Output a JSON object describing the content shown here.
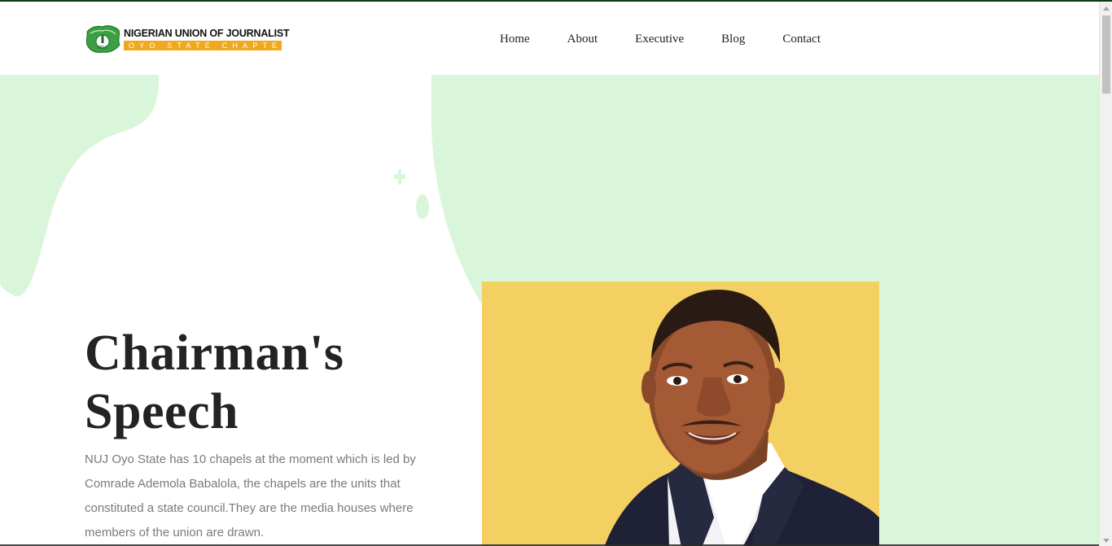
{
  "header": {
    "logo_title": "NIGERIAN UNION OF JOURNALIST",
    "logo_subtitle": "OYO STATE CHAPTER",
    "logo_badge": "NUJ"
  },
  "nav": {
    "items": [
      {
        "label": "Home"
      },
      {
        "label": "About"
      },
      {
        "label": "Executive"
      },
      {
        "label": "Blog"
      },
      {
        "label": "Contact"
      }
    ]
  },
  "hero": {
    "title_line1": "Chairman's",
    "title_line2": "Speech",
    "body": "NUJ Oyo State has 10 chapels at the moment which is led by Comrade Ademola Babalola, the chapels are the units that constituted a state council.They are the media houses where members of the union are drawn."
  },
  "colors": {
    "blob": "#d9f6da",
    "portrait_bg": "#f4cf62",
    "logo_accent": "#f0a81e",
    "heading": "#232323",
    "body_text": "#7a7a7a"
  }
}
